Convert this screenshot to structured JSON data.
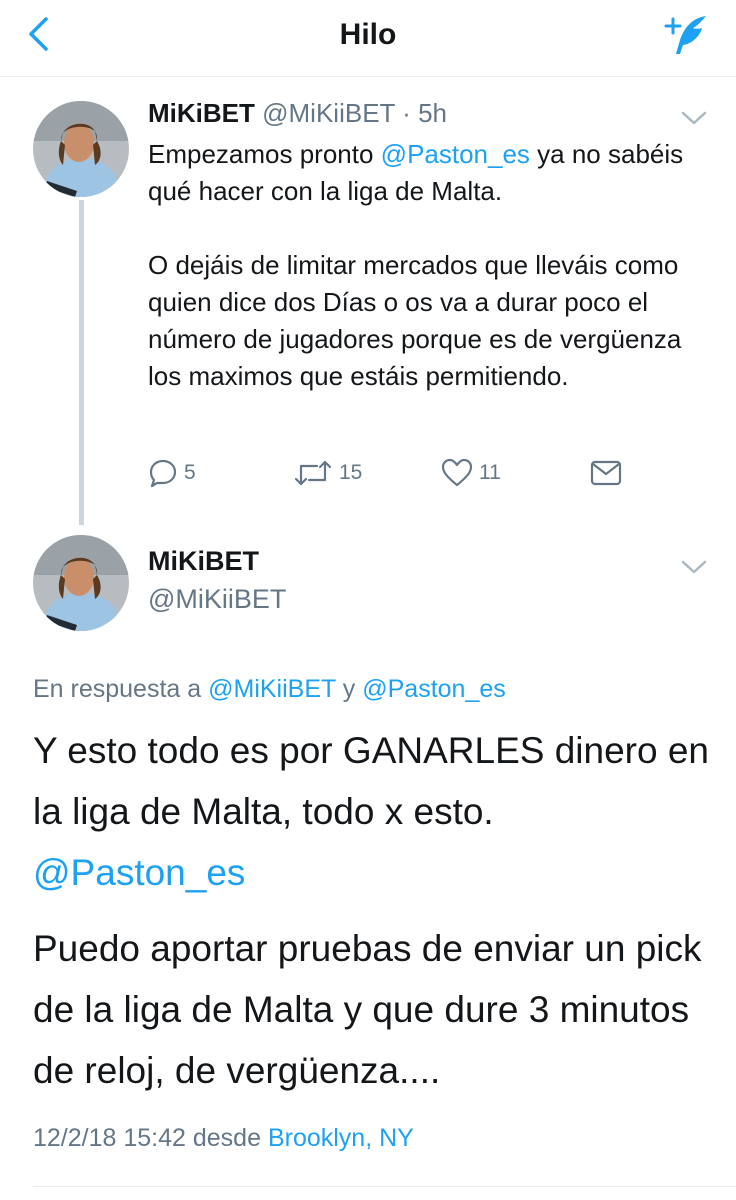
{
  "header": {
    "title": "Hilo",
    "back_icon": "chevron-left-icon",
    "compose_icon": "compose-tweet-icon"
  },
  "colors": {
    "accent": "#1da1f2",
    "muted": "#657786",
    "text": "#14171a",
    "thread_line": "#cdd6dd"
  },
  "tweet1": {
    "name": "MiKiBET",
    "handle": "@MiKiiBET",
    "separator": " · ",
    "time": "5h",
    "text_line1_before": "Empezamos pronto ",
    "mention": "@Paston_es",
    "text_line1_after": " ya no sabéis qué hacer con la liga de Malta.",
    "paragraph2": "O dejáis de limitar mercados que lleváis como quien dice dos Días o os va a durar poco el número de jugadores porque es de vergüenza los maximos que estáis permitiendo.",
    "replies": "5",
    "retweets": "15",
    "likes": "11"
  },
  "tweet2": {
    "name": "MiKiBET",
    "handle": "@MiKiiBET",
    "reply_prefix": "En respuesta a ",
    "reply_user1": "@MiKiiBET",
    "reply_and": " y ",
    "reply_user2": "@Paston_es",
    "text_p1": "Y esto todo es por GANARLES dinero en la liga de Malta, todo x esto.",
    "mention": "@Paston_es",
    "text_p2": "Puedo aportar pruebas de enviar un pick de la liga de Malta y que dure 3 minutos de reloj, de vergüenza....",
    "timestamp": "12/2/18 15:42",
    "desde": " desde ",
    "location": "Brooklyn, NY"
  }
}
